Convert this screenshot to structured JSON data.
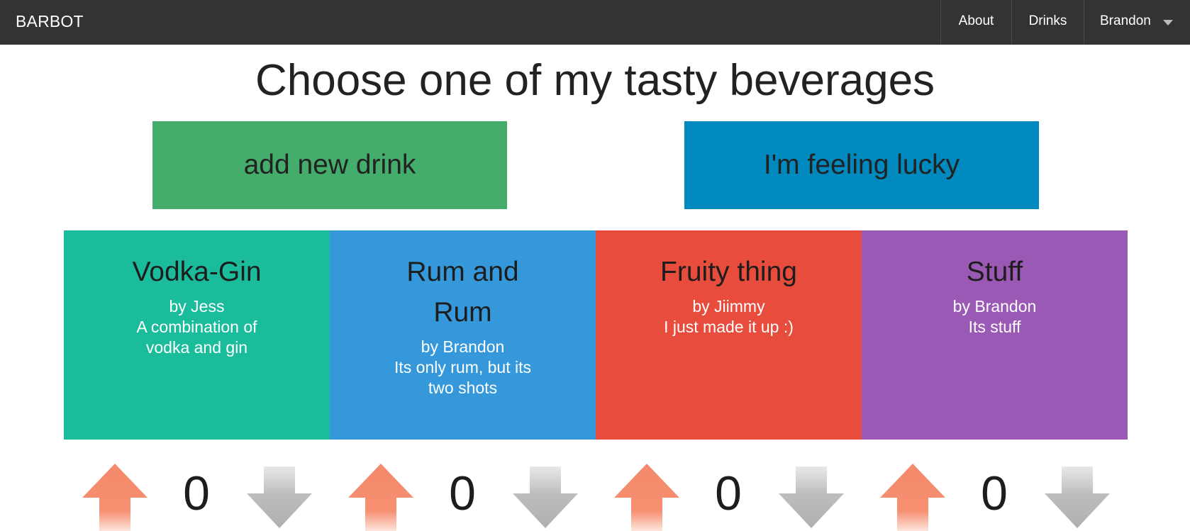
{
  "navbar": {
    "brand": "BARBOT",
    "items": [
      {
        "label": "About"
      },
      {
        "label": "Drinks"
      }
    ],
    "user": {
      "label": "Brandon"
    }
  },
  "main": {
    "title": "Choose one of my tasty beverages",
    "add_button": "add new drink",
    "lucky_button": "I'm feeling lucky"
  },
  "drinks": [
    {
      "name": "Vodka-Gin",
      "author": "by Jess",
      "description": "A combination of vodka and gin",
      "votes": "0",
      "color": "#1abc9c"
    },
    {
      "name": "Rum and Rum",
      "author": "by Brandon",
      "description": "Its only rum, but its two shots",
      "votes": "0",
      "color": "#3498db"
    },
    {
      "name": "Fruity thing",
      "author": "by Jiimmy",
      "description": "I just made it up :)",
      "votes": "0",
      "color": "#e74c3c"
    },
    {
      "name": "Stuff",
      "author": "by Brandon",
      "description": "Its stuff",
      "votes": "0",
      "color": "#9b59b6"
    }
  ],
  "colors": {
    "navbar": "#333333",
    "add_button": "#44ad6b",
    "lucky_button": "#0089be",
    "upvote_arrow": "#f4896a",
    "downvote_arrow": "#b3b3b3"
  }
}
